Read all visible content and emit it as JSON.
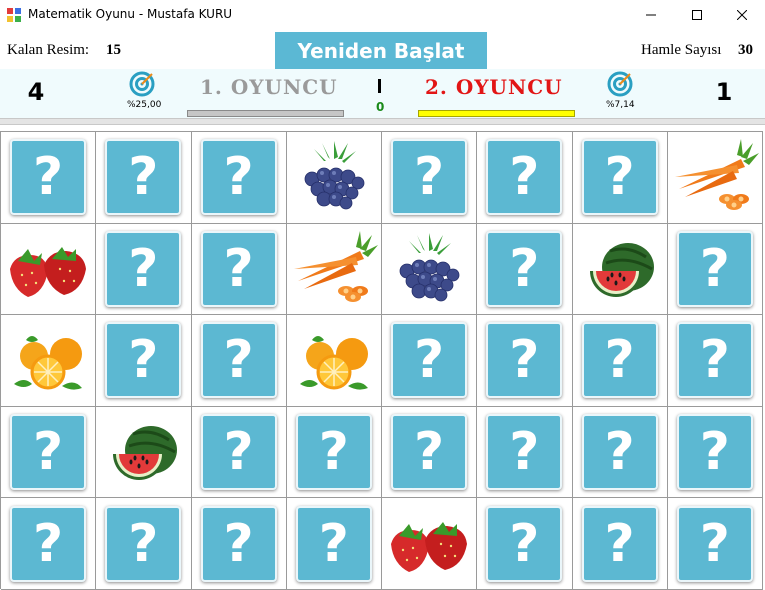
{
  "window": {
    "title": "Matematik Oyunu - Mustafa KURU",
    "min_icon": "minimize-icon",
    "max_icon": "maximize-icon",
    "close_icon": "close-icon"
  },
  "header": {
    "remaining_label": "Kalan Resim:",
    "remaining_value": "15",
    "restart_label": "Yeniden Başlat",
    "moves_label": "Hamle Sayısı",
    "moves_value": "30"
  },
  "players": {
    "p1": {
      "score": "4",
      "name": "1. OYUNCU",
      "percent": "%25,00",
      "icon": "target-icon",
      "bar_color": "#c6c6c6",
      "name_color": "#9a9a9a"
    },
    "p2": {
      "score": "1",
      "name": "2. OYUNCU",
      "percent": "%7,14",
      "icon": "target-icon",
      "bar_color": "#ffff00",
      "name_color": "#e21515"
    },
    "turn_count": "0"
  },
  "colors": {
    "card": "#5cb8d2",
    "restart_bg": "#5bb8d4",
    "scorebar_bg": "#f0fbfd"
  },
  "board": {
    "hidden_symbol": "?",
    "rows": [
      [
        "hidden",
        "hidden",
        "hidden",
        "blueberries",
        "hidden",
        "hidden",
        "hidden",
        "carrots"
      ],
      [
        "strawberries",
        "hidden",
        "hidden",
        "carrots",
        "blueberries",
        "hidden",
        "watermelon",
        "hidden"
      ],
      [
        "oranges",
        "hidden",
        "hidden",
        "oranges",
        "hidden",
        "hidden",
        "hidden",
        "hidden"
      ],
      [
        "hidden",
        "watermelon",
        "hidden",
        "hidden",
        "hidden",
        "hidden",
        "hidden",
        "hidden"
      ],
      [
        "hidden",
        "hidden",
        "hidden",
        "hidden",
        "strawberries",
        "hidden",
        "hidden",
        "hidden"
      ]
    ]
  }
}
